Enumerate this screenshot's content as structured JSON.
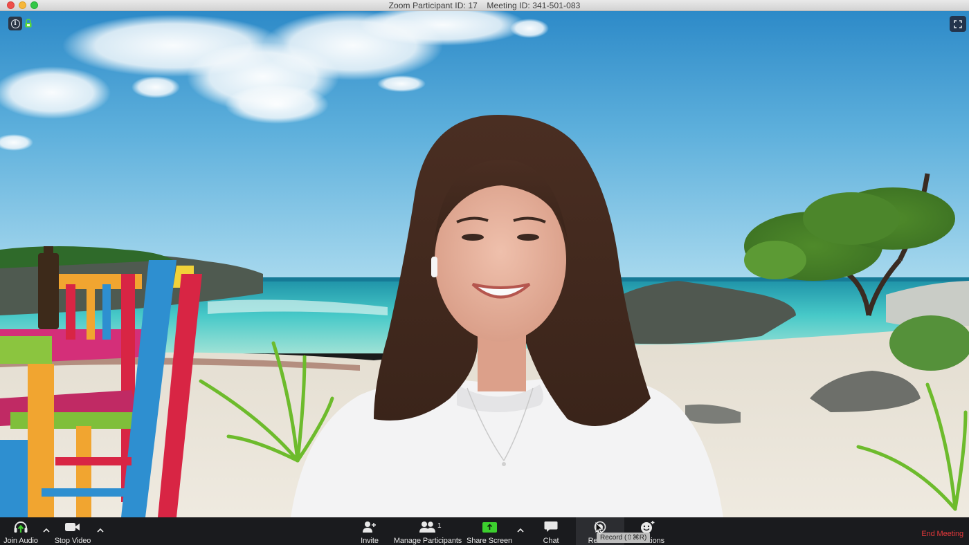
{
  "window": {
    "title_participant": "Zoom Participant ID: 17",
    "title_meeting": "Meeting ID: 341-501-083"
  },
  "video": {
    "info_icon": "info-icon",
    "encryption_icon": "lock-icon",
    "fullscreen_icon": "fullscreen-icon",
    "virtual_background": "tropical beach with colorful chairs, tree and rocks",
    "participant": "smiling woman with long brown hair in white t-shirt"
  },
  "toolbar": {
    "join_audio": "Join Audio",
    "stop_video": "Stop Video",
    "invite": "Invite",
    "manage_participants": "Manage Participants",
    "participant_count": "1",
    "share_screen": "Share Screen",
    "chat": "Chat",
    "record": "Record",
    "reactions": "Reactions",
    "end_meeting": "End Meeting",
    "record_tooltip": "Record (⇧⌘R)"
  },
  "colors": {
    "toolbar_bg": "#1a1b1e",
    "share_green": "#3ccf2e",
    "join_audio_arrow": "#3ccf2e",
    "end_meeting_red": "#e5383b",
    "lock_green": "#5ad935"
  }
}
